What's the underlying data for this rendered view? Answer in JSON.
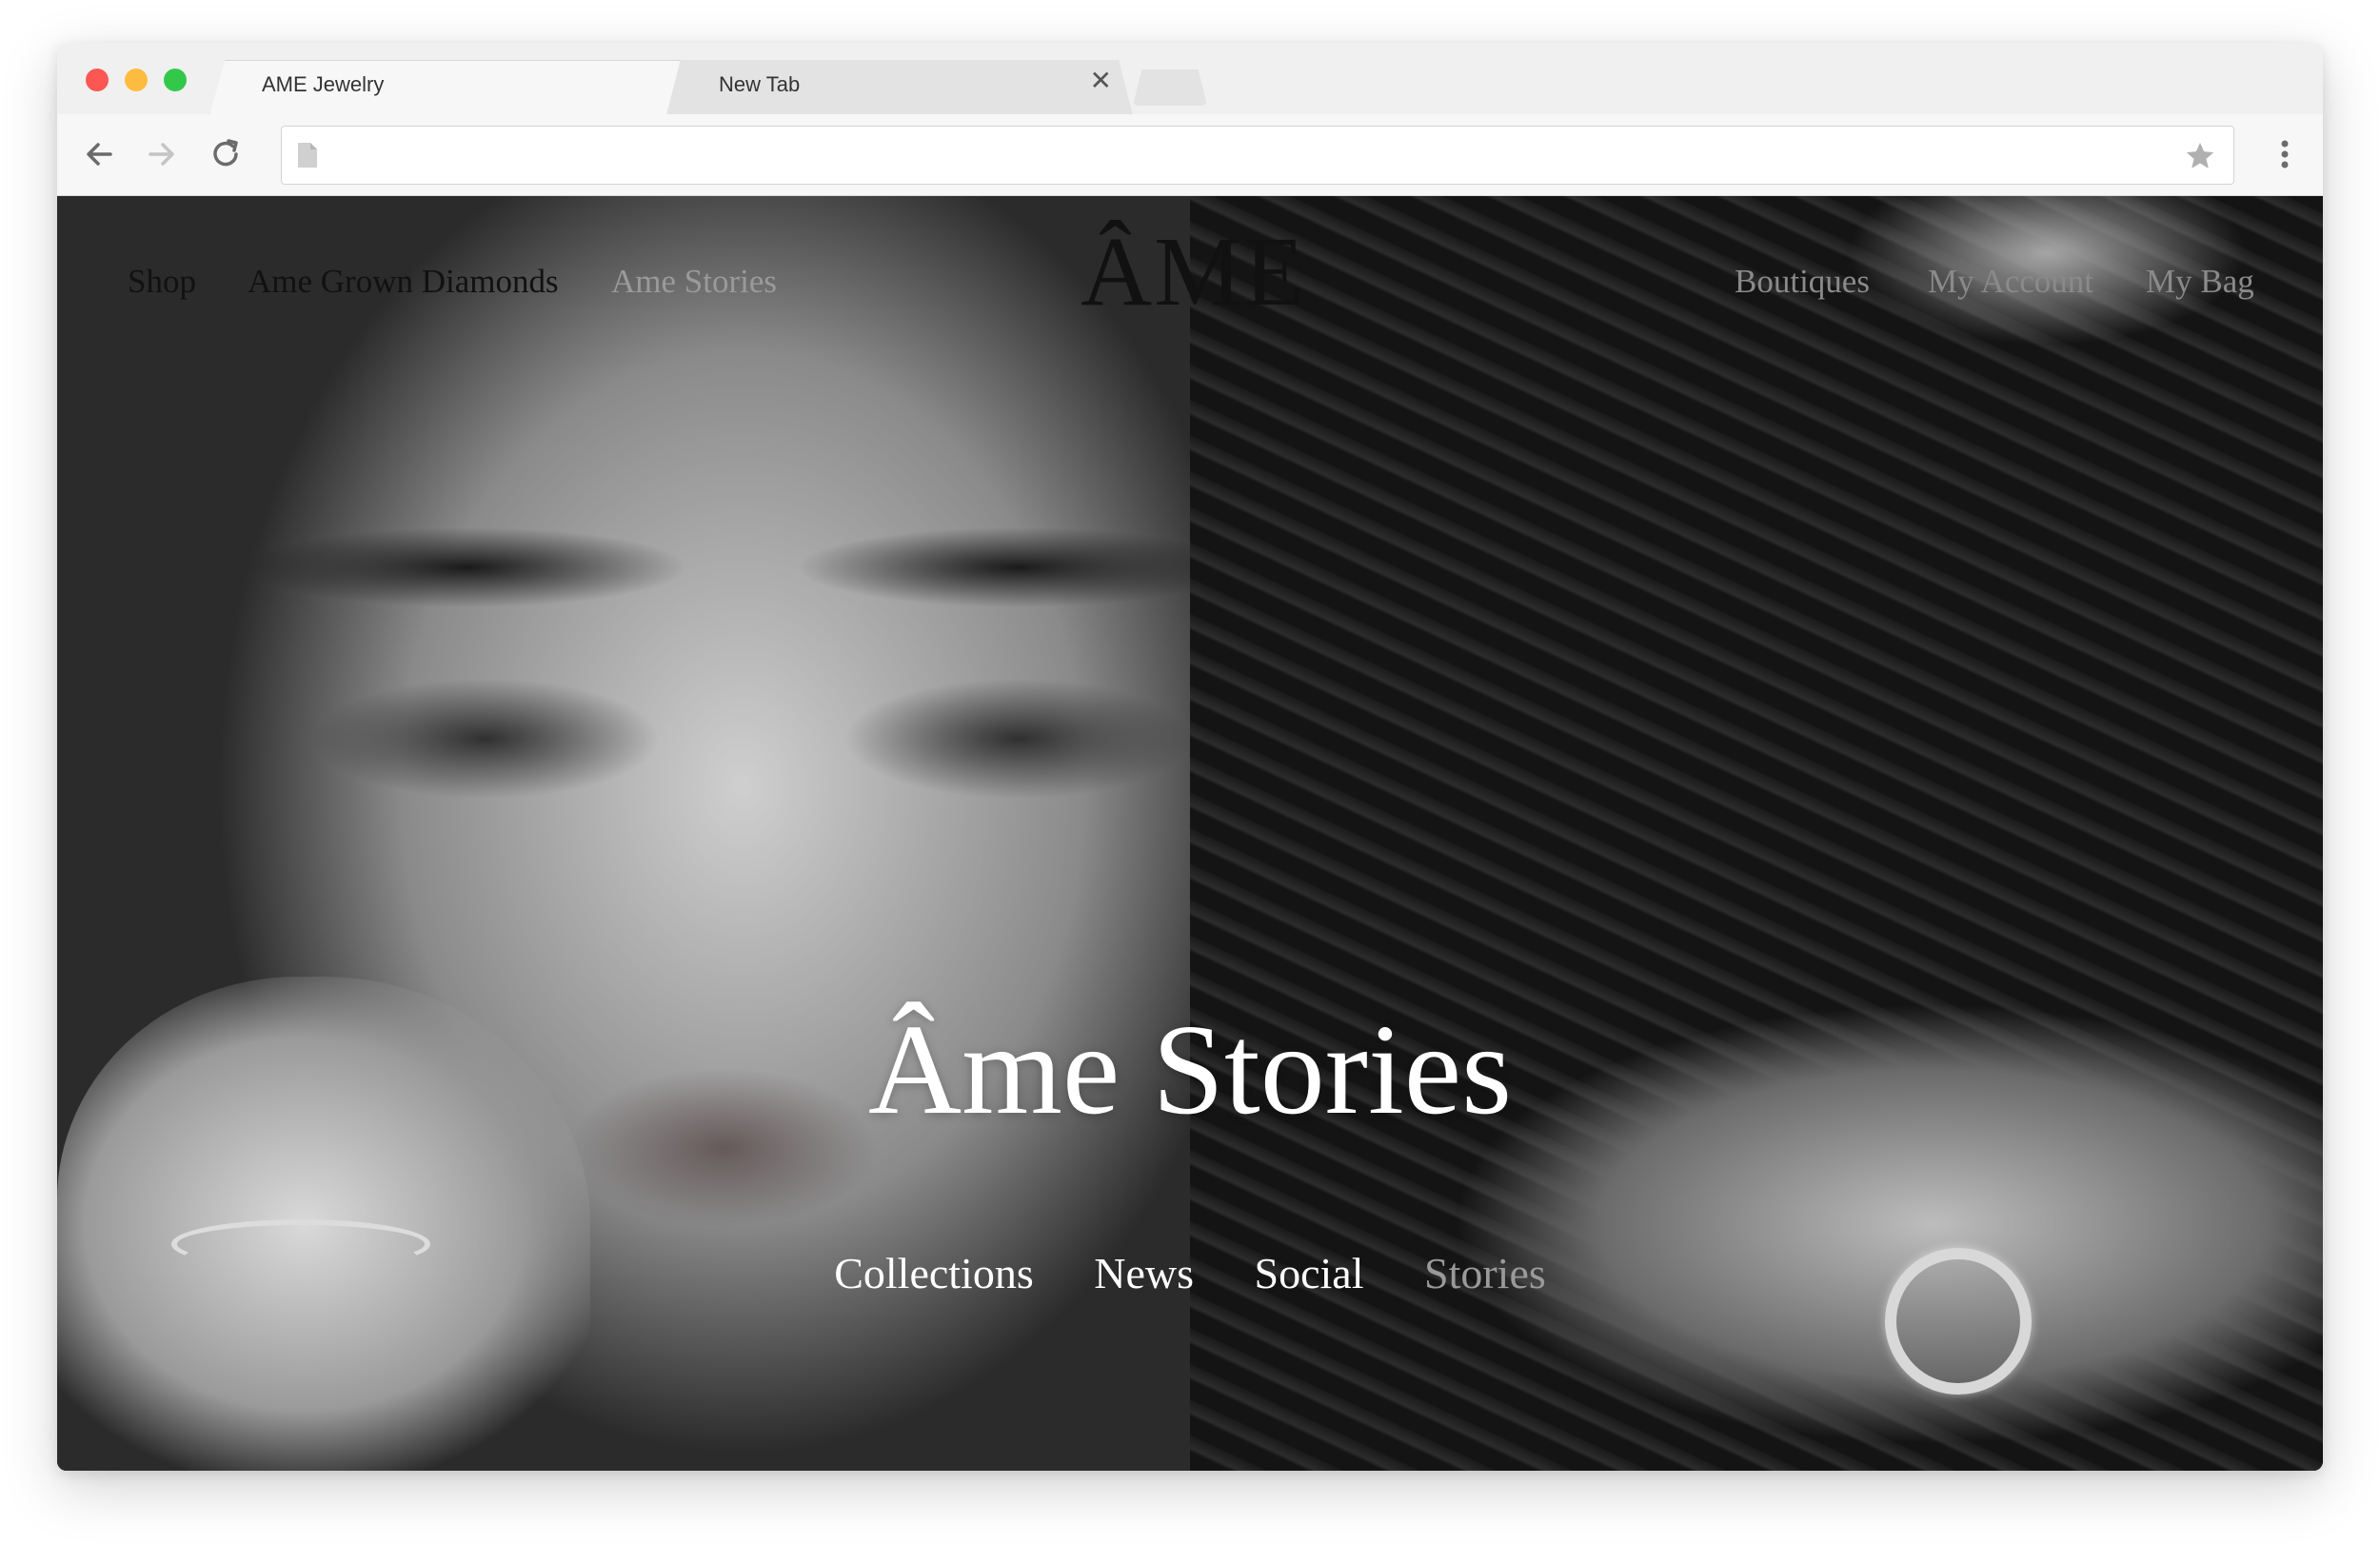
{
  "browser": {
    "tabs": [
      {
        "title": "AME Jewelry",
        "active": true
      },
      {
        "title": "New Tab",
        "active": false
      }
    ],
    "close_glyph": "✕",
    "address": {
      "value": "",
      "placeholder": ""
    },
    "icons": [
      "back-arrow-icon",
      "forward-arrow-icon",
      "reload-icon",
      "page-icon",
      "star-icon",
      "more-vert-icon"
    ]
  },
  "site": {
    "nav_left": [
      "Shop",
      "Ame Grown Diamonds",
      "Ame Stories"
    ],
    "logo": "ÂME",
    "nav_right": [
      "Boutiques",
      "My Account",
      "My Bag"
    ],
    "hero_title": "Âme Stories",
    "sub_nav": [
      "Collections",
      "News",
      "Social",
      "Stories"
    ]
  },
  "colors": {
    "traffic_red": "#fc5753",
    "traffic_yellow": "#fdbc40",
    "traffic_green": "#34c84a",
    "nav_dark": "#111111",
    "nav_muted": "#8a8a8a",
    "hero_text": "#ffffff"
  }
}
